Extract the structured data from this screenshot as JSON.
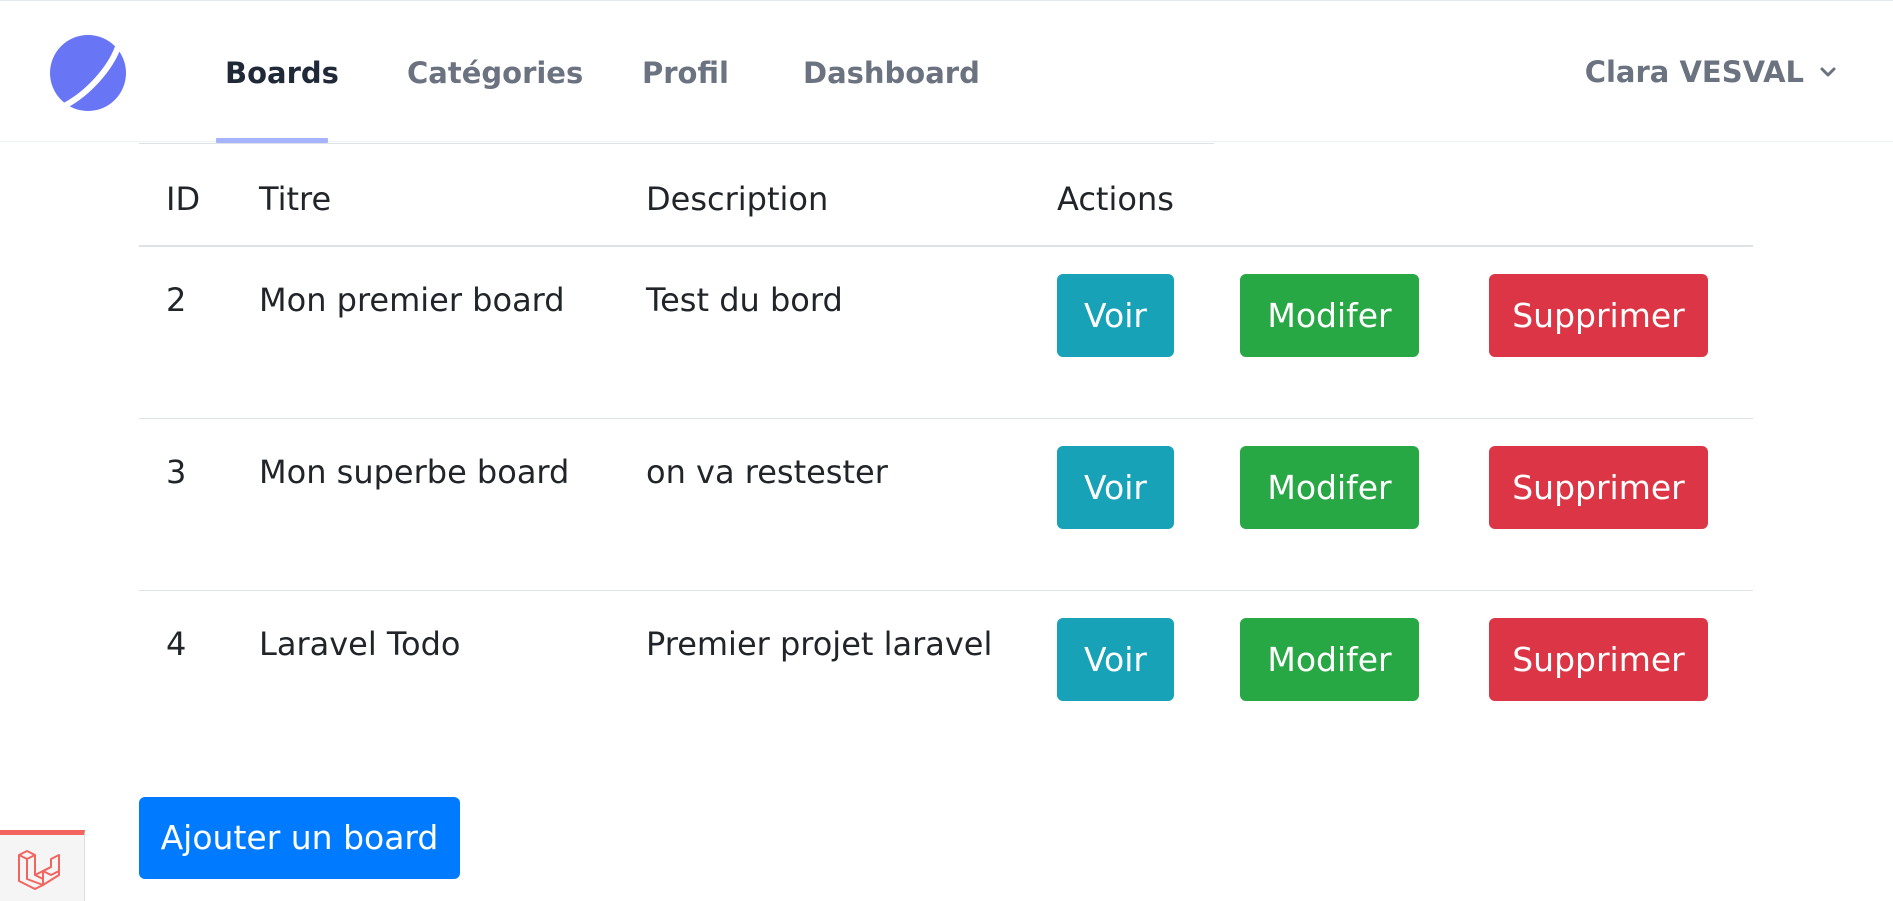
{
  "header": {
    "logo_icon": "planet-logo-icon",
    "nav": [
      {
        "label": "Boards",
        "active": true
      },
      {
        "label": "Catégories",
        "active": false
      },
      {
        "label": "Profil",
        "active": false
      },
      {
        "label": "Dashboard",
        "active": false
      }
    ],
    "user": {
      "name": "Clara VESVAL",
      "icon": "chevron-down-icon"
    }
  },
  "table": {
    "columns": [
      "ID",
      "Titre",
      "Description",
      "Actions"
    ],
    "rows": [
      {
        "id": "2",
        "title": "Mon premier board",
        "description": "Test du bord"
      },
      {
        "id": "3",
        "title": "Mon superbe board",
        "description": "on va restester"
      },
      {
        "id": "4",
        "title": "Laravel Todo",
        "description": "Premier projet laravel"
      }
    ],
    "actions": {
      "view": "Voir",
      "edit": "Modifer",
      "delete": "Supprimer"
    }
  },
  "add_button": "Ajouter un board",
  "debugbar": {
    "icon": "laravel-icon"
  },
  "colors": {
    "view": "#17a2b8",
    "edit": "#28a745",
    "delete": "#dc3545",
    "primary": "#007bff",
    "logo": "#6875f5",
    "nav_active_underline": "#a5b4fc"
  }
}
